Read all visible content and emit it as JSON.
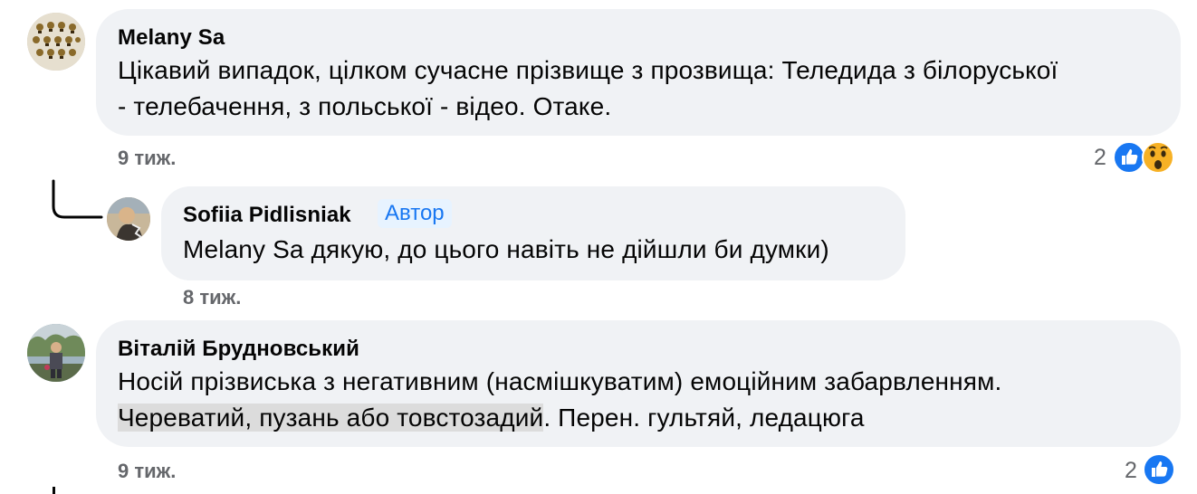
{
  "comments": [
    {
      "author": "Melany Sa",
      "lines": [
        "Цікавий випадок, цілком сучасне прізвище з прозвища: Теледида з білоруської",
        "- телебачення, з польської - відео. Отаке."
      ],
      "time": "9 тиж.",
      "reaction_count": "2",
      "reactions": [
        "like-icon",
        "wow-icon"
      ]
    },
    {
      "author": "Sofiia Pidlisniak",
      "badge": "Автор",
      "text": "Melany Sa дякую, до цього навіть не дійшли би думки)",
      "time": "8 тиж."
    },
    {
      "author": "Віталій Брудновський",
      "line1": "Носій прізвиська з негативним (насмішкуватим) емоційним забарвленням.",
      "line2_highlight": "Череватий, пузань або товстозадий",
      "line2_rest": ". Перен. гультяй, ледацюга",
      "time": "9 тиж.",
      "reaction_count": "2",
      "reactions": [
        "like-icon"
      ]
    }
  ],
  "colors": {
    "bubble": "#f0f2f5",
    "meta_text": "#65676b",
    "like_blue": "#1877f2",
    "author_badge_bg": "#e7f3ff",
    "highlight": "#dcdcdc"
  }
}
